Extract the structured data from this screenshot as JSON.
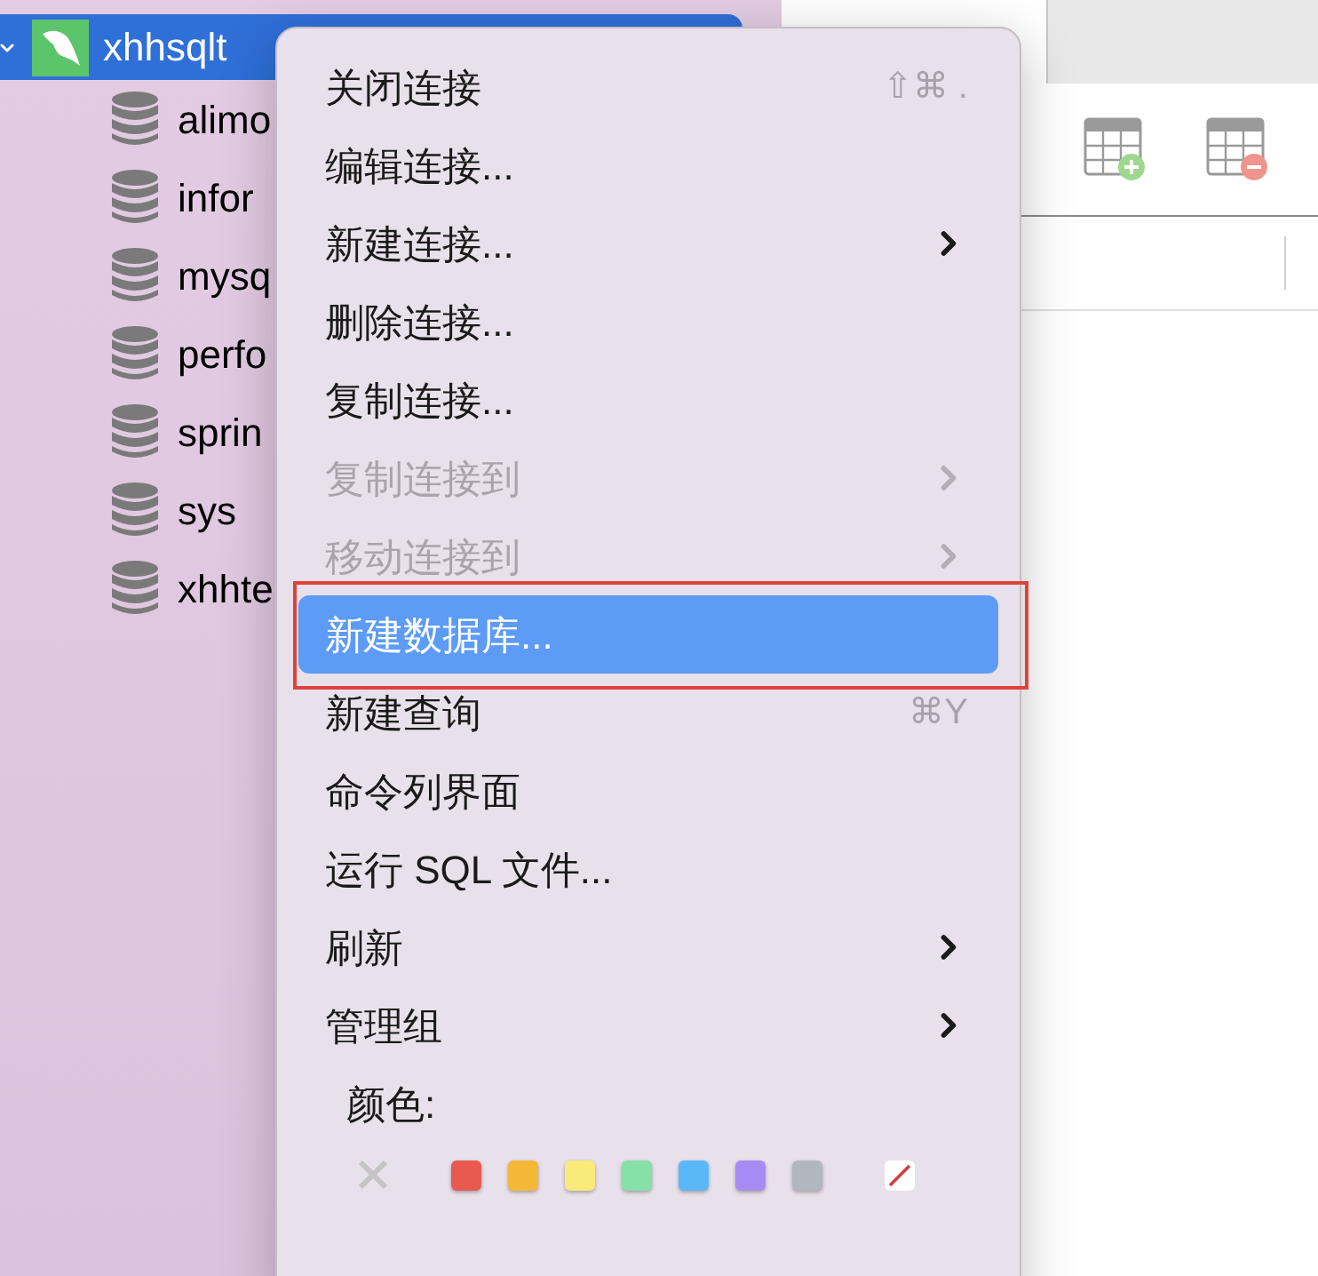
{
  "sidebar": {
    "connection": {
      "name": "xhhsqlt",
      "selected": true,
      "expanded": true,
      "children": [
        {
          "name": "alimo"
        },
        {
          "name": "infor"
        },
        {
          "name": "mysq"
        },
        {
          "name": "perfo"
        },
        {
          "name": "sprin"
        },
        {
          "name": "sys"
        },
        {
          "name": "xhhte"
        }
      ]
    }
  },
  "main": {
    "tabs": [
      {
        "selected": true
      }
    ]
  },
  "context_menu": {
    "items": [
      {
        "label": "关闭连接",
        "shortcut": "⇧⌘ .",
        "disabled": false,
        "submenu": false,
        "selected": false
      },
      {
        "label": "编辑连接...",
        "disabled": false,
        "submenu": false,
        "selected": false
      },
      {
        "label": "新建连接...",
        "disabled": false,
        "submenu": true,
        "selected": false
      },
      {
        "label": "删除连接...",
        "disabled": false,
        "submenu": false,
        "selected": false
      },
      {
        "label": "复制连接...",
        "disabled": false,
        "submenu": false,
        "selected": false
      },
      {
        "label": "复制连接到",
        "disabled": true,
        "submenu": true,
        "selected": false
      },
      {
        "label": "移动连接到",
        "disabled": true,
        "submenu": true,
        "selected": false
      },
      {
        "label": "新建数据库...",
        "disabled": false,
        "submenu": false,
        "selected": true
      },
      {
        "label": "新建查询",
        "shortcut": "⌘Y",
        "disabled": false,
        "submenu": false,
        "selected": false
      },
      {
        "label": "命令列界面",
        "disabled": false,
        "submenu": false,
        "selected": false
      },
      {
        "label": "运行 SQL 文件...",
        "disabled": false,
        "submenu": false,
        "selected": false
      },
      {
        "label": "刷新",
        "disabled": false,
        "submenu": true,
        "selected": false
      },
      {
        "label": "管理组",
        "disabled": false,
        "submenu": true,
        "selected": false
      }
    ],
    "color_label": "颜色:",
    "colors": [
      {
        "kind": "none"
      },
      {
        "kind": "swatch",
        "color": "#e85a50"
      },
      {
        "kind": "swatch",
        "color": "#f5b836"
      },
      {
        "kind": "swatch",
        "color": "#faea7b"
      },
      {
        "kind": "swatch",
        "color": "#86e0a8"
      },
      {
        "kind": "swatch",
        "color": "#5ab8f8"
      },
      {
        "kind": "swatch",
        "color": "#a78bf5"
      },
      {
        "kind": "swatch",
        "color": "#b0b7be"
      },
      {
        "kind": "clear"
      }
    ]
  }
}
